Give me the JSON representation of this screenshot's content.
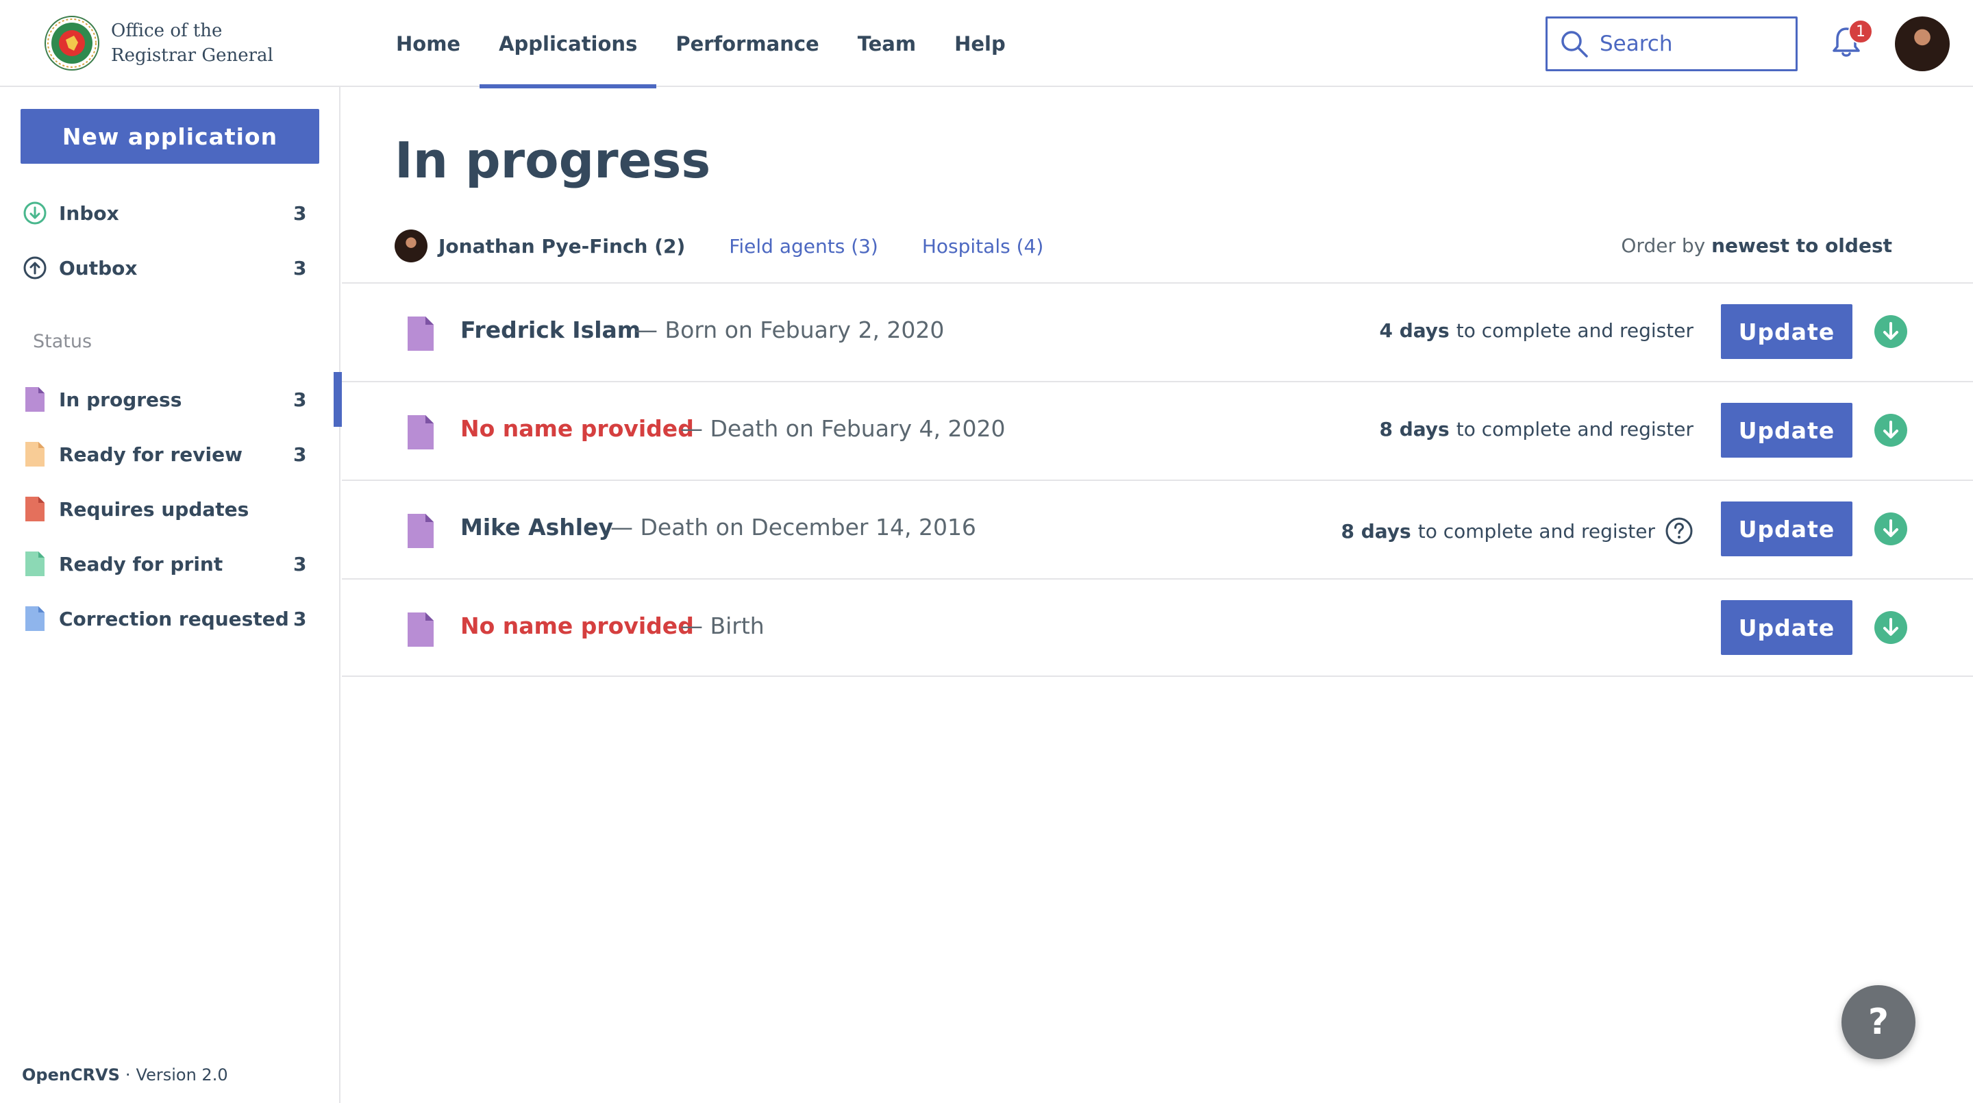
{
  "header": {
    "org_line1": "Office of the",
    "org_line2": "Registrar General",
    "logo_icon": "registrar-seal-icon",
    "nav": [
      {
        "label": "Home",
        "active": false
      },
      {
        "label": "Applications",
        "active": true
      },
      {
        "label": "Performance",
        "active": false
      },
      {
        "label": "Team",
        "active": false
      },
      {
        "label": "Help",
        "active": false
      }
    ],
    "search_placeholder": "Search",
    "notification_count": "1",
    "accent_color": "#4c68c1"
  },
  "sidebar": {
    "new_application_label": "New application",
    "top_items": [
      {
        "label": "Inbox",
        "count": "3",
        "icon": "arrow-down-circle-icon"
      },
      {
        "label": "Outbox",
        "count": "3",
        "icon": "arrow-up-circle-icon"
      }
    ],
    "status_heading": "Status",
    "status_items": [
      {
        "label": "In progress",
        "count": "3",
        "color": "#b88dd4",
        "active": true
      },
      {
        "label": "Ready for review",
        "count": "3",
        "color": "#f8cc96"
      },
      {
        "label": "Requires updates",
        "count": "",
        "color": "#e4705c"
      },
      {
        "label": "Ready for print",
        "count": "3",
        "color": "#8cd9b5"
      },
      {
        "label": "Correction requested",
        "count": "3",
        "color": "#8fb5ec"
      }
    ],
    "footer_brand": "OpenCRVS",
    "footer_separator": "·",
    "footer_version": "Version 2.0"
  },
  "main": {
    "title": "In progress",
    "filters": [
      {
        "label": "Jonathan Pye-Finch (2)",
        "active": true
      },
      {
        "label": "Field agents (3)",
        "active": false
      },
      {
        "label": "Hospitals (4)",
        "active": false
      }
    ],
    "order_prefix": "Order by",
    "order_value": "newest to oldest",
    "rows": [
      {
        "name": "Fredrick Islam",
        "name_missing": false,
        "event": "— Born on Febuary 2, 2020",
        "due_days": "4 days",
        "due_text": "to complete and register",
        "has_help": false,
        "button": "Update"
      },
      {
        "name": "No name provided",
        "name_missing": true,
        "event": "— Death on Febuary 4, 2020",
        "due_days": "8 days",
        "due_text": "to complete and register",
        "has_help": false,
        "button": "Update"
      },
      {
        "name": "Mike Ashley",
        "name_missing": false,
        "event": "— Death on December 14, 2016",
        "due_days": "8 days",
        "due_text": "to complete and register",
        "has_help": true,
        "button": "Update"
      },
      {
        "name": "No name provided",
        "name_missing": true,
        "event": "— Birth",
        "due_days": "",
        "due_text": "",
        "has_help": false,
        "button": "Update"
      }
    ],
    "help_fab_label": "?"
  }
}
